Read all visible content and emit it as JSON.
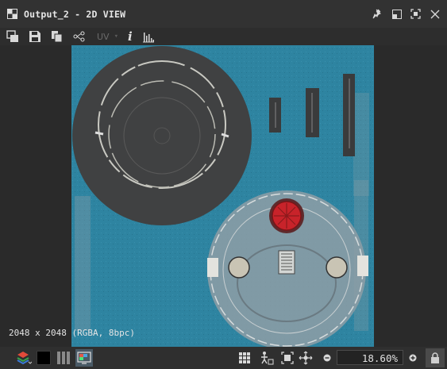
{
  "window": {
    "title": "Output_2 - 2D VIEW"
  },
  "toolbar": {
    "uv_label": "UV",
    "info_label": "i"
  },
  "viewport": {
    "resolution_label": "2048 x 2048 (RGBA, 8bpc)",
    "texture_background_color": "#2e84a1",
    "gauge_center_color": "#c8232a"
  },
  "bottombar": {
    "zoom_value": "18.60%"
  },
  "icons": {
    "title": "2d-view-icon",
    "pin": "pin-icon",
    "restore": "restore-icon",
    "maximize": "maximize-icon",
    "close": "close-icon",
    "copy_to_clipboard": "copy-image-icon",
    "save": "save-icon",
    "export": "export-icon",
    "share": "share-graph-icon",
    "histogram": "histogram-icon",
    "layers": "layers-icon",
    "channel_black": "channel-color-icon",
    "channel_split": "split-view-icon",
    "display": "display-mode-icon",
    "grid": "grid-icon",
    "transform": "transform-icon",
    "fit": "fit-to-view-icon",
    "pan": "pan-icon",
    "zoom_out": "zoom-out-icon",
    "zoom_in": "zoom-in-icon",
    "lock": "lock-icon"
  }
}
